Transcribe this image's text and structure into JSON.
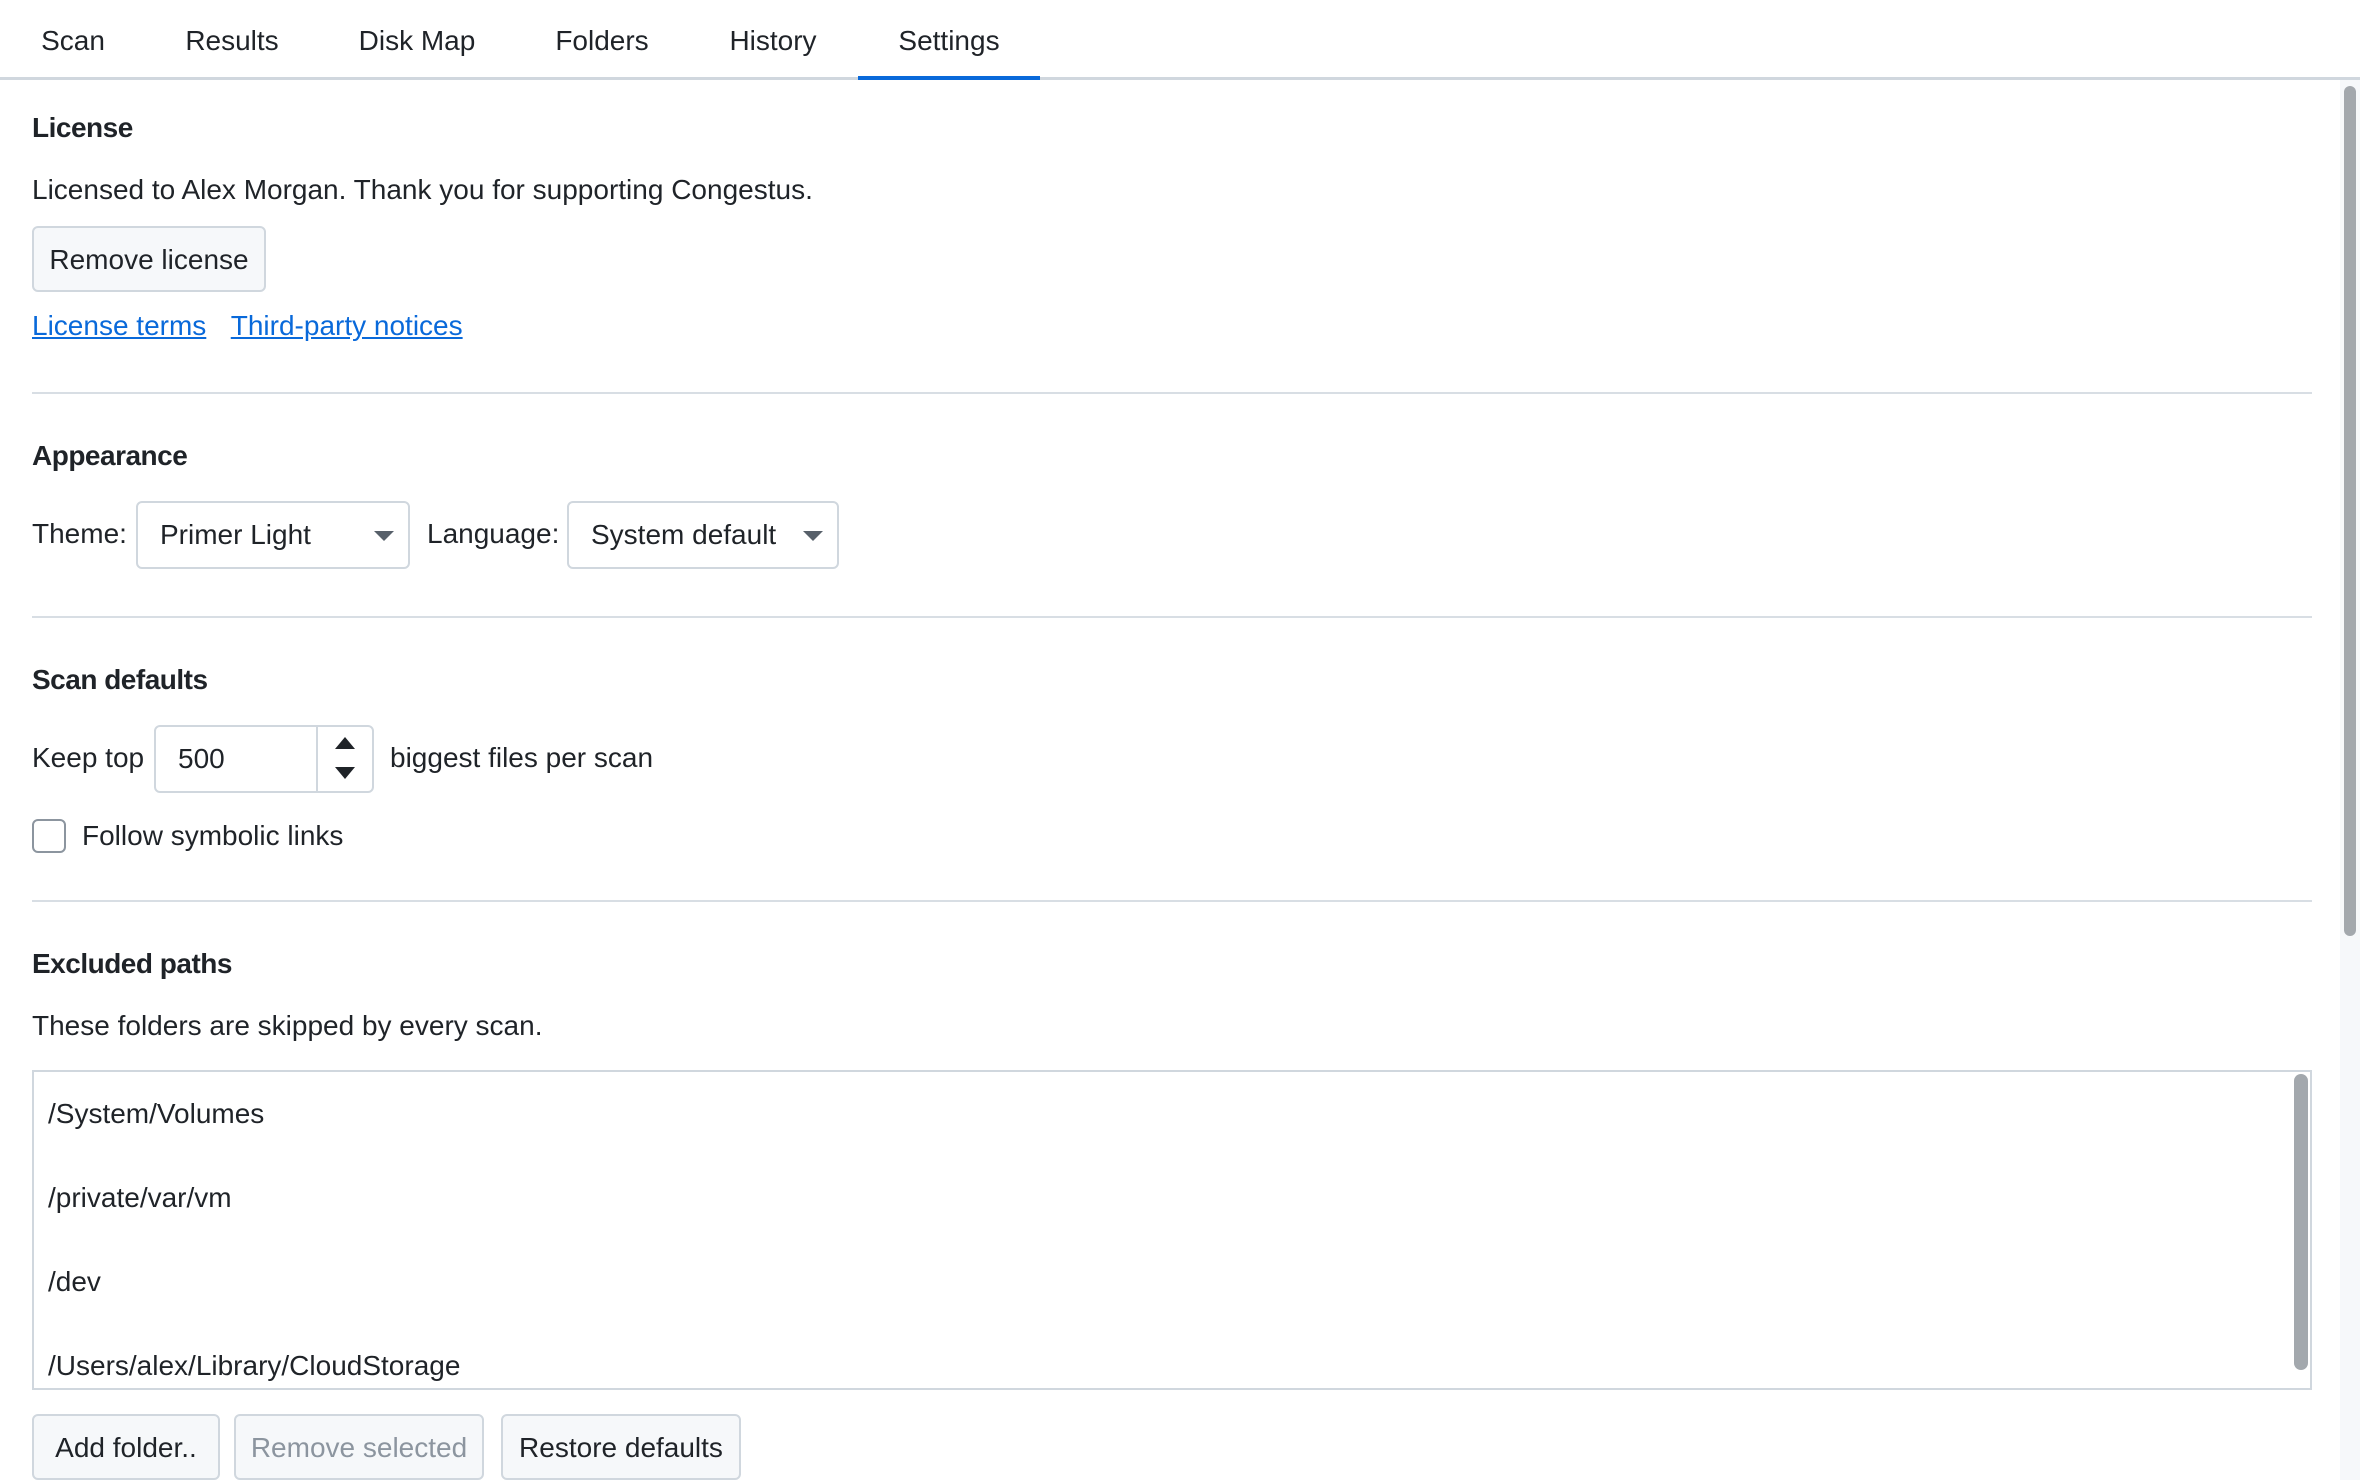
{
  "tabs": [
    {
      "label": "Scan"
    },
    {
      "label": "Results"
    },
    {
      "label": "Disk Map"
    },
    {
      "label": "Folders"
    },
    {
      "label": "History"
    },
    {
      "label": "Settings"
    }
  ],
  "active_tab": "Settings",
  "license": {
    "heading": "License",
    "status_text": "Licensed to Alex Morgan. Thank you for supporting Congestus.",
    "remove_button": "Remove license",
    "links": {
      "terms": "License terms",
      "notices": "Third-party notices"
    }
  },
  "appearance": {
    "heading": "Appearance",
    "theme_label": "Theme:",
    "theme_value": "Primer Light",
    "language_label": "Language:",
    "language_value": "System default"
  },
  "scan_defaults": {
    "heading": "Scan defaults",
    "keep_top_label": "Keep top",
    "keep_top_value": "500",
    "keep_top_suffix": "biggest files per scan",
    "follow_symlinks_label": "Follow symbolic links",
    "follow_symlinks_checked": false
  },
  "excluded_paths": {
    "heading": "Excluded paths",
    "description": "These folders are skipped by every scan.",
    "paths": [
      "/System/Volumes",
      "/private/var/vm",
      "/dev",
      "/Users/alex/Library/CloudStorage"
    ],
    "add_button": "Add folder..",
    "remove_button": "Remove selected",
    "restore_button": "Restore defaults"
  },
  "colors": {
    "accent": "#0969da",
    "border": "#d0d7de",
    "disabled_text": "#8c959f"
  }
}
